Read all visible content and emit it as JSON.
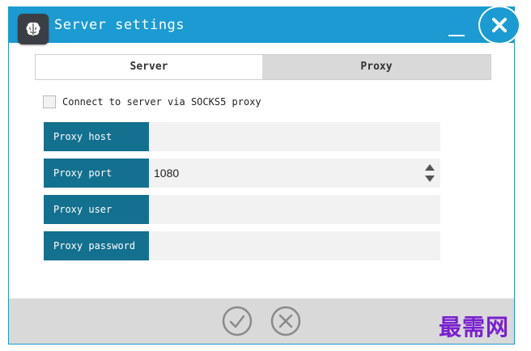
{
  "window": {
    "title": "Server settings"
  },
  "tabs": [
    {
      "label": "Server",
      "active": false
    },
    {
      "label": "Proxy",
      "active": true
    }
  ],
  "socks_checkbox": {
    "label": "Connect to server via SOCKS5 proxy",
    "checked": false
  },
  "fields": {
    "host": {
      "label": "Proxy host",
      "value": ""
    },
    "port": {
      "label": "Proxy port",
      "value": "1080"
    },
    "user": {
      "label": "Proxy user",
      "value": ""
    },
    "password": {
      "label": "Proxy password",
      "value": ""
    }
  },
  "icons": {
    "app": "brain-icon",
    "minimize": "minimize-icon",
    "close": "close-icon",
    "ok": "checkmark-circle-icon",
    "cancel": "x-circle-icon",
    "spin_up": "triangle-up-icon",
    "spin_down": "triangle-down-icon"
  },
  "colors": {
    "titlebar": "#1b9bd1",
    "label_bg": "#14708f",
    "watermark": "#7a1fd0"
  },
  "watermark": "最需网"
}
